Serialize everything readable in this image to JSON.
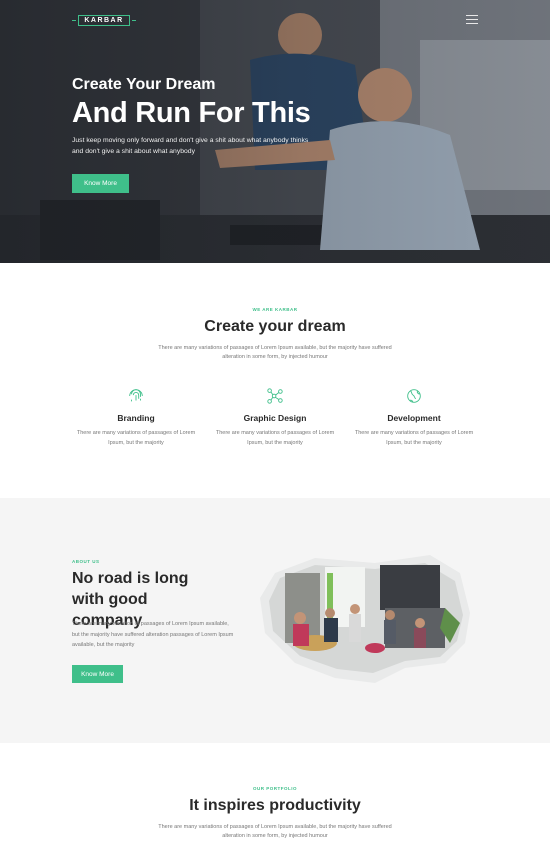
{
  "brand": {
    "logo_text": "KARBAR"
  },
  "hero": {
    "subtitle": "Create Your Dream",
    "title": "And Run For This",
    "text": "Just keep moving only forward and don't give a shit about what anybody thinks and don't give a shit about what anybody",
    "button": "Know More"
  },
  "intro": {
    "eyebrow": "WE ARE KARBAR",
    "title": "Create your dream",
    "text": "There are many variations of passages of Lorem Ipsum available, but the majority have suffered alteration in some form, by injected humour",
    "features": [
      {
        "icon": "fingerprint-icon",
        "title": "Branding",
        "text": "There are many variations of passages of Lorem Ipsum, but the majority"
      },
      {
        "icon": "network-nodes-icon",
        "title": "Graphic Design",
        "text": "There are many variations of passages of Lorem Ipsum, but the majority"
      },
      {
        "icon": "globe-icon",
        "title": "Development",
        "text": "There are many variations of passages of Lorem Ipsum, but the majority"
      }
    ]
  },
  "about": {
    "eyebrow": "ABOUT US",
    "title": "No road is long with good company",
    "text": "There are many variation of passages of Lorem Ipsum available, but the majority have suffered alteration passages of Lorem Ipsum available, but the majority",
    "button": "Know More"
  },
  "portfolio": {
    "eyebrow": "OUR PORTFOLIO",
    "title": "It inspires productivity",
    "text": "There are many variations of passages of Lorem Ipsum available, but the majority have suffered alteration in some form, by injected humour"
  },
  "colors": {
    "accent": "#3fbf8a",
    "dark_text": "#2a2a2a",
    "muted_text": "#777777",
    "section_bg": "#f5f5f5"
  }
}
